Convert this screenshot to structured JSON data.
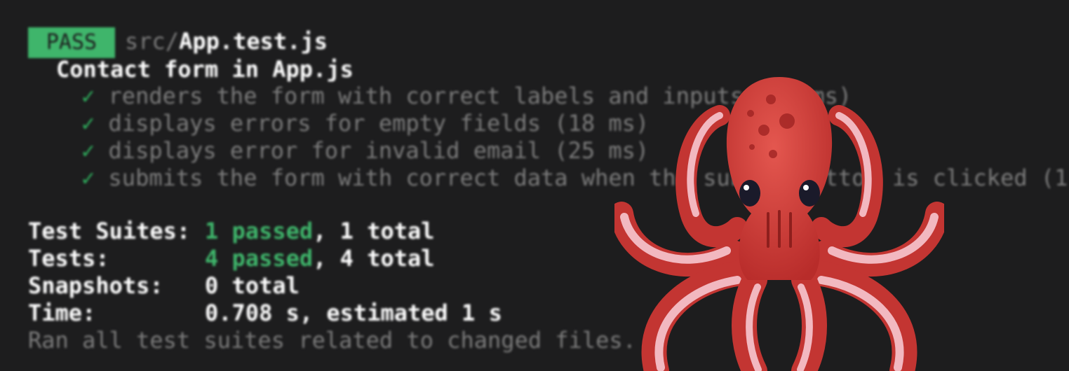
{
  "pass_badge": "PASS",
  "file": {
    "dir": "src/",
    "name": "App.test.js"
  },
  "describe": "Contact form in App.js",
  "check_glyph": "✓",
  "tests": [
    "renders the form with correct labels and inputs (43 ms)",
    "displays errors for empty fields (18 ms)",
    "displays error for invalid email (25 ms)",
    "submits the form with correct data when the submit button is clicked (1"
  ],
  "summary": {
    "suites_label": "Test Suites:",
    "suites_passed": "1 passed",
    "suites_total": ", 1 total",
    "tests_label": "Tests:",
    "tests_passed": "4 passed",
    "tests_total": ", 4 total",
    "snapshots_label": "Snapshots:",
    "snapshots_value": "0 total",
    "time_label": "Time:",
    "time_value": "0.708 s, estimated 1 s",
    "footer": "Ran all test suites related to changed files."
  },
  "colors": {
    "background": "#1d1d1e",
    "pass_green": "#3fb56b",
    "octopus_red": "#d8403b"
  },
  "icons": {
    "mascot": "octopus-icon"
  }
}
